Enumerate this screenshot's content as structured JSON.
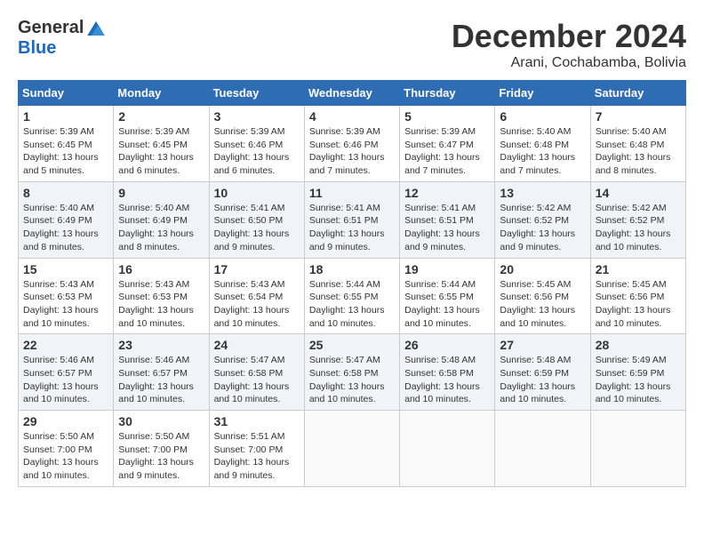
{
  "logo": {
    "general": "General",
    "blue": "Blue"
  },
  "header": {
    "month": "December 2024",
    "location": "Arani, Cochabamba, Bolivia"
  },
  "weekdays": [
    "Sunday",
    "Monday",
    "Tuesday",
    "Wednesday",
    "Thursday",
    "Friday",
    "Saturday"
  ],
  "weeks": [
    [
      {
        "day": "1",
        "sunrise": "5:39 AM",
        "sunset": "6:45 PM",
        "daylight": "13 hours and 5 minutes."
      },
      {
        "day": "2",
        "sunrise": "5:39 AM",
        "sunset": "6:45 PM",
        "daylight": "13 hours and 6 minutes."
      },
      {
        "day": "3",
        "sunrise": "5:39 AM",
        "sunset": "6:46 PM",
        "daylight": "13 hours and 6 minutes."
      },
      {
        "day": "4",
        "sunrise": "5:39 AM",
        "sunset": "6:46 PM",
        "daylight": "13 hours and 7 minutes."
      },
      {
        "day": "5",
        "sunrise": "5:39 AM",
        "sunset": "6:47 PM",
        "daylight": "13 hours and 7 minutes."
      },
      {
        "day": "6",
        "sunrise": "5:40 AM",
        "sunset": "6:48 PM",
        "daylight": "13 hours and 7 minutes."
      },
      {
        "day": "7",
        "sunrise": "5:40 AM",
        "sunset": "6:48 PM",
        "daylight": "13 hours and 8 minutes."
      }
    ],
    [
      {
        "day": "8",
        "sunrise": "5:40 AM",
        "sunset": "6:49 PM",
        "daylight": "13 hours and 8 minutes."
      },
      {
        "day": "9",
        "sunrise": "5:40 AM",
        "sunset": "6:49 PM",
        "daylight": "13 hours and 8 minutes."
      },
      {
        "day": "10",
        "sunrise": "5:41 AM",
        "sunset": "6:50 PM",
        "daylight": "13 hours and 9 minutes."
      },
      {
        "day": "11",
        "sunrise": "5:41 AM",
        "sunset": "6:51 PM",
        "daylight": "13 hours and 9 minutes."
      },
      {
        "day": "12",
        "sunrise": "5:41 AM",
        "sunset": "6:51 PM",
        "daylight": "13 hours and 9 minutes."
      },
      {
        "day": "13",
        "sunrise": "5:42 AM",
        "sunset": "6:52 PM",
        "daylight": "13 hours and 9 minutes."
      },
      {
        "day": "14",
        "sunrise": "5:42 AM",
        "sunset": "6:52 PM",
        "daylight": "13 hours and 10 minutes."
      }
    ],
    [
      {
        "day": "15",
        "sunrise": "5:43 AM",
        "sunset": "6:53 PM",
        "daylight": "13 hours and 10 minutes."
      },
      {
        "day": "16",
        "sunrise": "5:43 AM",
        "sunset": "6:53 PM",
        "daylight": "13 hours and 10 minutes."
      },
      {
        "day": "17",
        "sunrise": "5:43 AM",
        "sunset": "6:54 PM",
        "daylight": "13 hours and 10 minutes."
      },
      {
        "day": "18",
        "sunrise": "5:44 AM",
        "sunset": "6:55 PM",
        "daylight": "13 hours and 10 minutes."
      },
      {
        "day": "19",
        "sunrise": "5:44 AM",
        "sunset": "6:55 PM",
        "daylight": "13 hours and 10 minutes."
      },
      {
        "day": "20",
        "sunrise": "5:45 AM",
        "sunset": "6:56 PM",
        "daylight": "13 hours and 10 minutes."
      },
      {
        "day": "21",
        "sunrise": "5:45 AM",
        "sunset": "6:56 PM",
        "daylight": "13 hours and 10 minutes."
      }
    ],
    [
      {
        "day": "22",
        "sunrise": "5:46 AM",
        "sunset": "6:57 PM",
        "daylight": "13 hours and 10 minutes."
      },
      {
        "day": "23",
        "sunrise": "5:46 AM",
        "sunset": "6:57 PM",
        "daylight": "13 hours and 10 minutes."
      },
      {
        "day": "24",
        "sunrise": "5:47 AM",
        "sunset": "6:58 PM",
        "daylight": "13 hours and 10 minutes."
      },
      {
        "day": "25",
        "sunrise": "5:47 AM",
        "sunset": "6:58 PM",
        "daylight": "13 hours and 10 minutes."
      },
      {
        "day": "26",
        "sunrise": "5:48 AM",
        "sunset": "6:58 PM",
        "daylight": "13 hours and 10 minutes."
      },
      {
        "day": "27",
        "sunrise": "5:48 AM",
        "sunset": "6:59 PM",
        "daylight": "13 hours and 10 minutes."
      },
      {
        "day": "28",
        "sunrise": "5:49 AM",
        "sunset": "6:59 PM",
        "daylight": "13 hours and 10 minutes."
      }
    ],
    [
      {
        "day": "29",
        "sunrise": "5:50 AM",
        "sunset": "7:00 PM",
        "daylight": "13 hours and 10 minutes."
      },
      {
        "day": "30",
        "sunrise": "5:50 AM",
        "sunset": "7:00 PM",
        "daylight": "13 hours and 9 minutes."
      },
      {
        "day": "31",
        "sunrise": "5:51 AM",
        "sunset": "7:00 PM",
        "daylight": "13 hours and 9 minutes."
      },
      null,
      null,
      null,
      null
    ]
  ]
}
